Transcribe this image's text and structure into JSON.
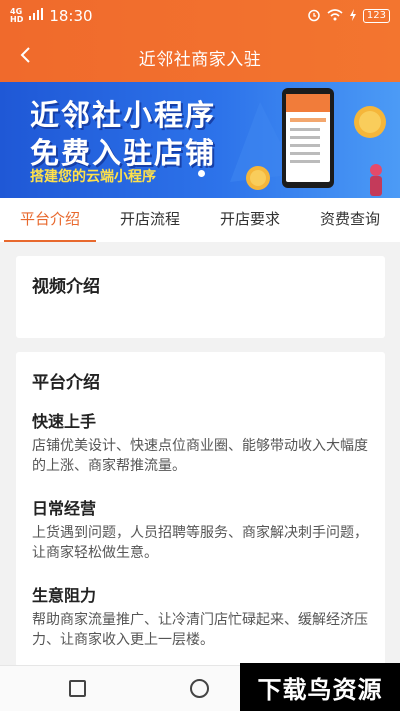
{
  "status_bar": {
    "network": "4G",
    "network_sub": "HD",
    "time": "18:30",
    "battery": "123"
  },
  "nav": {
    "title": "近邻社商家入驻"
  },
  "banner": {
    "line1": "近邻社小程序",
    "line2": "免费入驻店铺",
    "line3": "搭建您的云端小程序"
  },
  "tabs": [
    {
      "label": "平台介绍",
      "active": true
    },
    {
      "label": "开店流程"
    },
    {
      "label": "开店要求"
    },
    {
      "label": "资费查询"
    }
  ],
  "video_card": {
    "title": "视频介绍"
  },
  "platform_card": {
    "title": "平台介绍",
    "sections": [
      {
        "title": "快速上手",
        "text": "店铺优美设计、快速点位商业圈、能够带动收入大幅度的上涨、商家帮推流量。"
      },
      {
        "title": "日常经营",
        "text": "上货遇到问题，人员招聘等服务、商家解决刺手问题，让商家轻松做生意。"
      },
      {
        "title": "生意阻力",
        "text": "帮助商家流量推广、让冷清门店忙碌起来、缓解经济压力、让商家收入更上一层楼。"
      }
    ]
  },
  "watermark": "下载鸟资源",
  "colors": {
    "accent": "#e8692e",
    "header": "#f06a2c",
    "banner": "#2d73ea"
  }
}
